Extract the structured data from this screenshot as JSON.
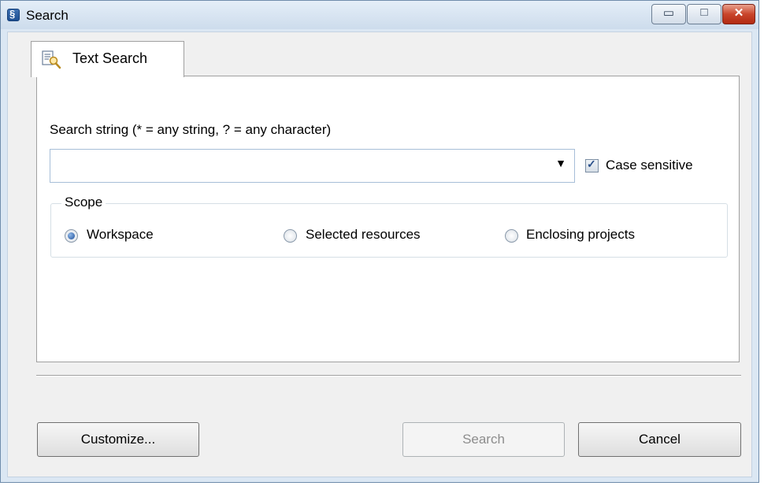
{
  "window": {
    "title": "Search",
    "icon": "eclipse-app-icon",
    "controls": {
      "minimize": "▭",
      "maximize": "□",
      "close": "✕"
    }
  },
  "tabs": [
    {
      "label": "Text Search",
      "icon": "text-search-icon",
      "selected": true
    }
  ],
  "search": {
    "label": "Search string (* = any string, ? = any character)",
    "value": "",
    "dropdown_arrow": "▼"
  },
  "case_sensitive": {
    "label": "Case sensitive",
    "checked": true
  },
  "scope": {
    "title": "Scope",
    "options": [
      {
        "label": "Workspace",
        "selected": true
      },
      {
        "label": "Selected resources",
        "selected": false
      },
      {
        "label": "Enclosing projects",
        "selected": false
      }
    ]
  },
  "buttons": {
    "customize": "Customize...",
    "search": "Search",
    "cancel": "Cancel"
  },
  "colors": {
    "title_bar": "#cddcec",
    "close_button": "#c9452b",
    "dialog_background": "#f0f0f0",
    "panel_background": "#ffffff",
    "radio_selected": "#1e4f9a",
    "checkbox_tick": "#2a4f8a"
  }
}
